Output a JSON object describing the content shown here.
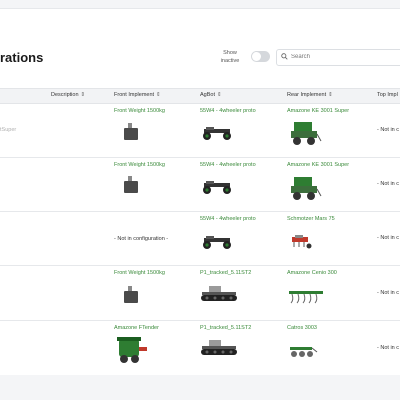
{
  "page": {
    "title": "rations"
  },
  "toolbar": {
    "show_inactive_label": "Show inactive",
    "search_placeholder": "Search"
  },
  "table": {
    "columns": [
      {
        "label": "Description",
        "sort": "⇕"
      },
      {
        "label": "Front Implement",
        "sort": "⇕"
      },
      {
        "label": "AgBot",
        "sort": "⇕"
      },
      {
        "label": "Rear Implement",
        "sort": "⇕"
      },
      {
        "label": "Top Impl",
        "sort": ""
      }
    ],
    "rows": [
      {
        "left_text": "tSuper",
        "front": "Front Weight 1500kg",
        "agbot": "55W4 - 4wheeler proto",
        "rear": "Amazone KE 3001 Super",
        "top": "- Not in c"
      },
      {
        "left_text": "",
        "front": "Front Weight 1500kg",
        "agbot": "55W4 - 4wheeler proto",
        "rear": "Amazone KE 3001 Super",
        "top": "- Not in c"
      },
      {
        "left_text": "",
        "front": "- Not in configuration -",
        "agbot": "55W4 - 4wheeler proto",
        "rear": "Schmotzer Mars 75",
        "top": "- Not in c"
      },
      {
        "left_text": "",
        "front": "Front Weight 1500kg",
        "agbot": "P1_tracked_5.11ST2",
        "rear": "Amazone Cenio 300",
        "top": "- Not in c"
      },
      {
        "left_text": "",
        "front": "Amazone FTender",
        "agbot": "P1_tracked_5.11ST2",
        "rear": "Catros 3003",
        "top": "- Not in c"
      }
    ]
  },
  "colors": {
    "link": "#3a8a3a",
    "implement_green": "#2e7d32",
    "header_bg": "#f2f3f5"
  }
}
